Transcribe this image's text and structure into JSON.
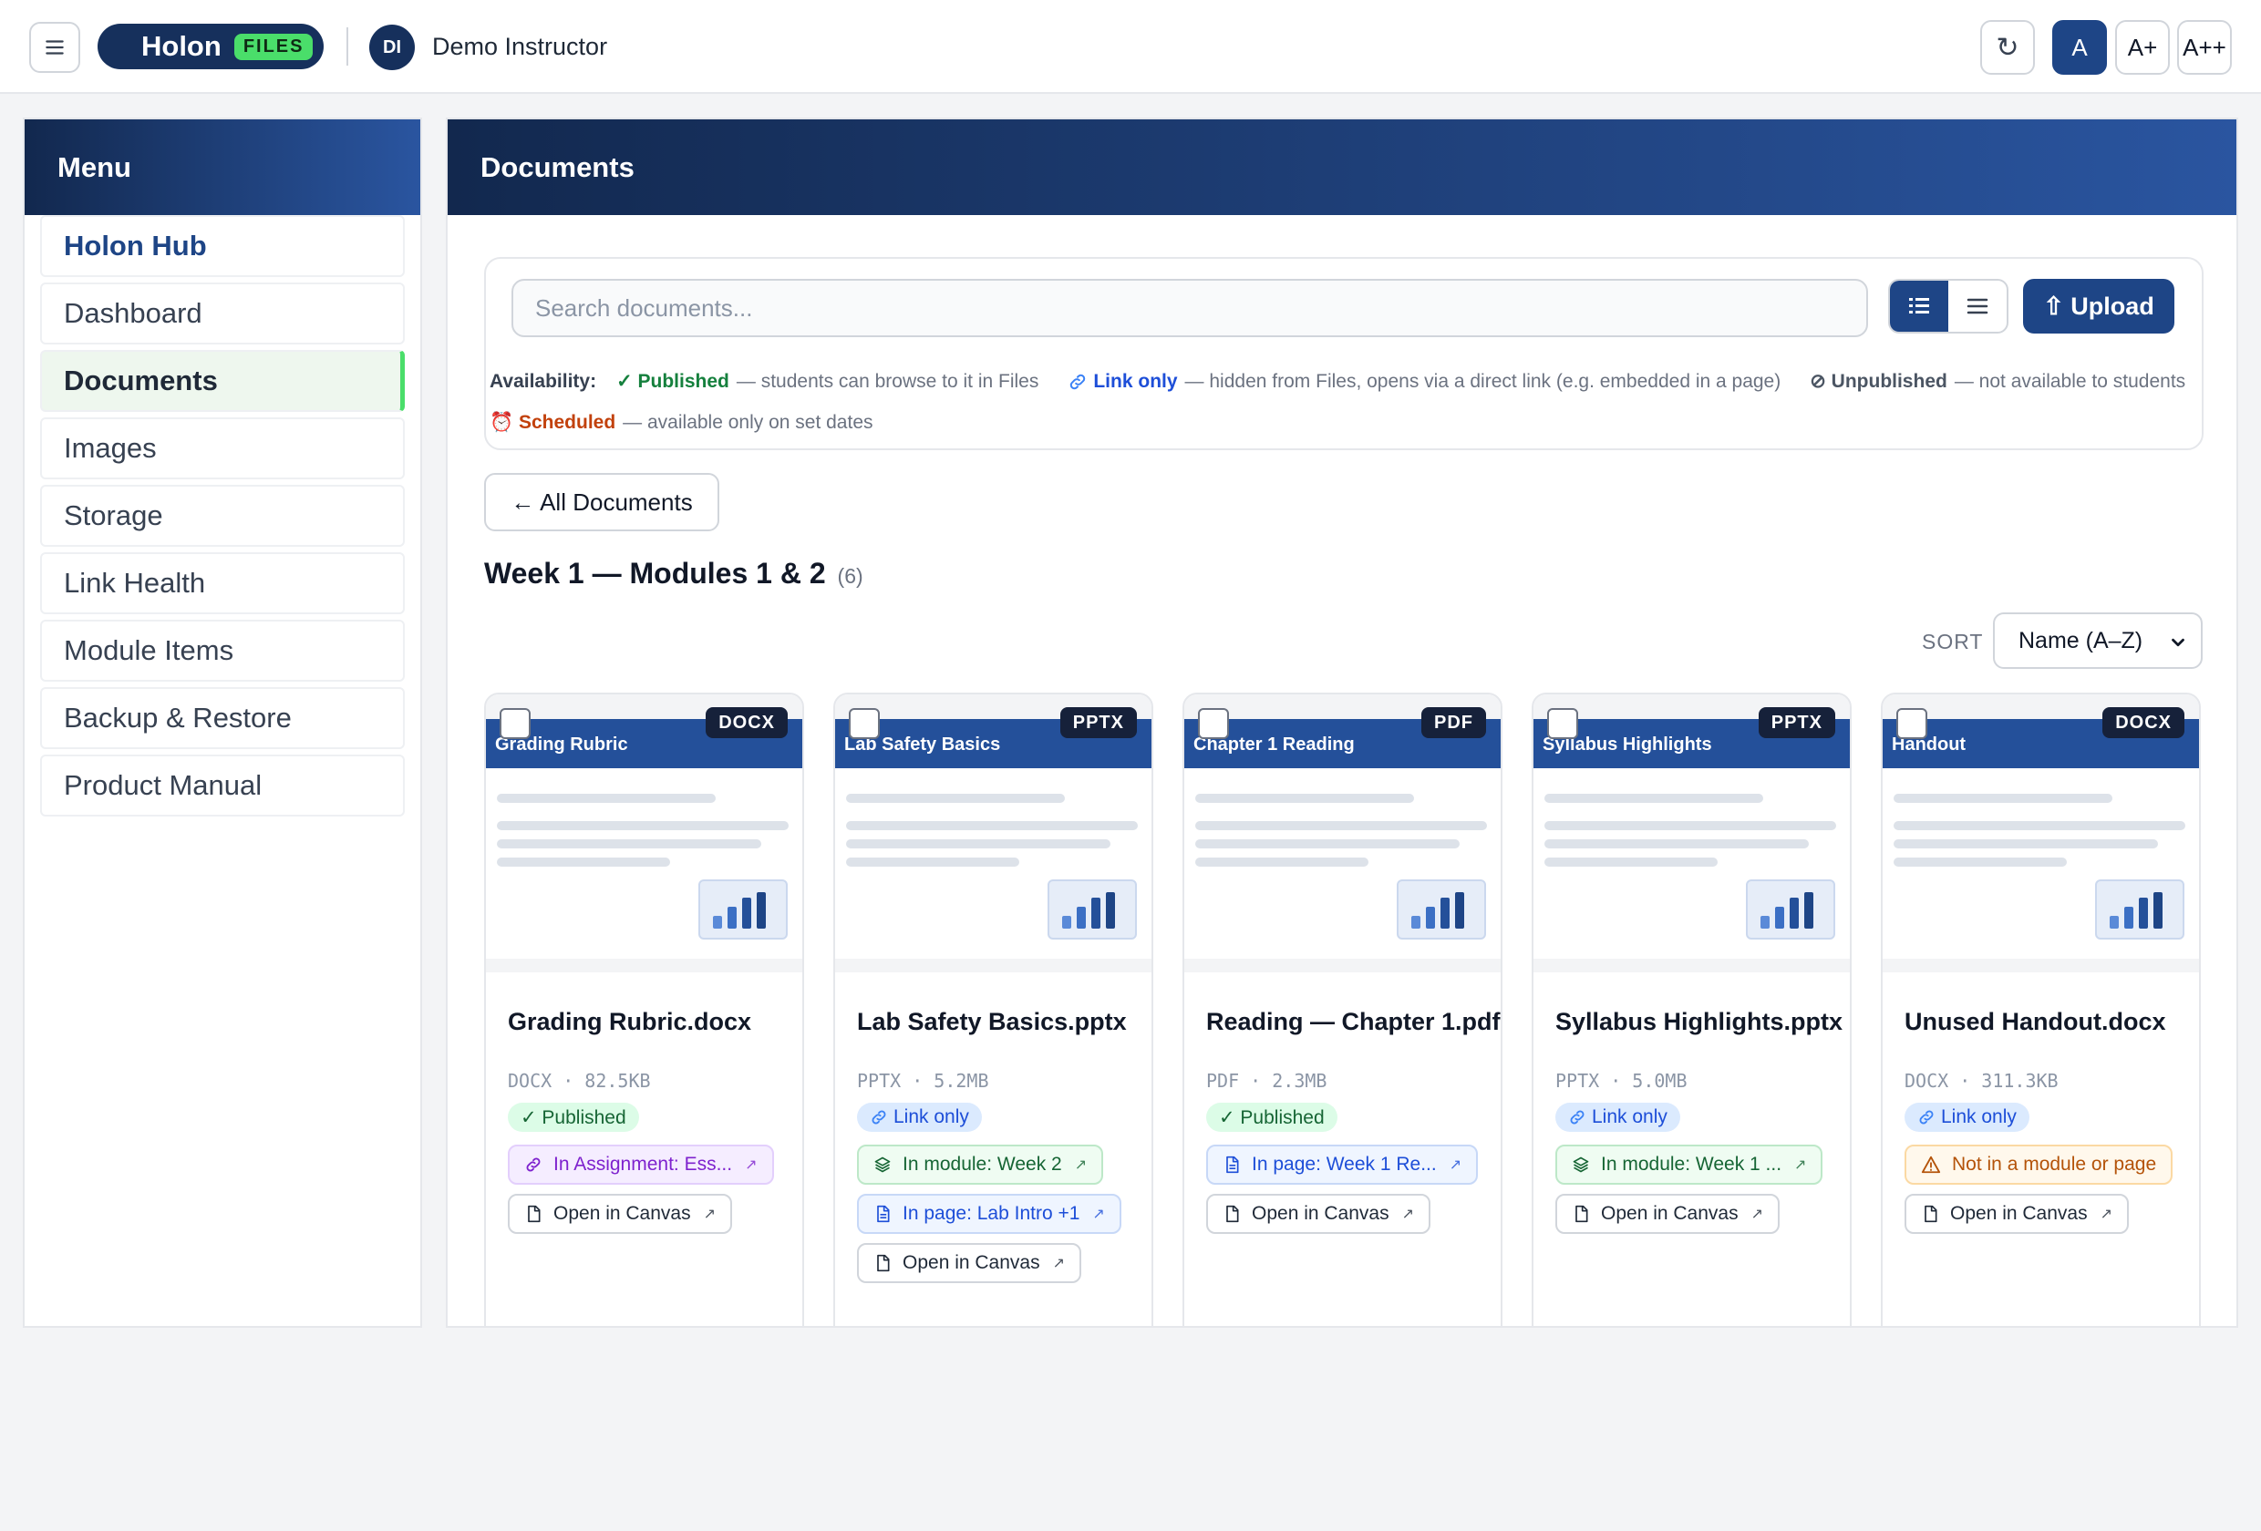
{
  "topbar": {
    "brand_name": "Holon",
    "brand_badge": "FILES",
    "avatar_initials": "DI",
    "user_name": "Demo Instructor",
    "refresh_glyph": "↻",
    "font_sizes": [
      "A",
      "A+",
      "A++"
    ],
    "active_font_size": "A"
  },
  "sidebar": {
    "title": "Menu",
    "items": [
      {
        "label": "Holon Hub"
      },
      {
        "label": "Dashboard"
      },
      {
        "label": "Documents"
      },
      {
        "label": "Images"
      },
      {
        "label": "Storage"
      },
      {
        "label": "Link Health"
      },
      {
        "label": "Module Items"
      },
      {
        "label": "Backup & Restore"
      },
      {
        "label": "Product Manual"
      }
    ],
    "active_item": "Documents"
  },
  "main": {
    "title": "Documents",
    "search": {
      "placeholder": "Search documents...",
      "value": ""
    },
    "upload_label": "⇧ Upload",
    "availability": {
      "label": "Availability:",
      "published_key": "✓ Published",
      "published_desc": "— students can browse to it in Files",
      "link_key": "Link only",
      "link_desc": "— hidden from Files, opens via a direct link (e.g. embedded in a page)",
      "unpublished_key": "⊘ Unpublished",
      "unpublished_desc": "— not available to students",
      "scheduled_key": "⏰ Scheduled",
      "scheduled_desc": "— available only on set dates"
    },
    "back_label": "← All Documents",
    "group_title": "Week 1 — Modules 1 & 2",
    "group_count": "(6)",
    "sort_label": "SORT",
    "sort_value": "Name (A–Z)"
  },
  "documents": [
    {
      "banner_title": "Grading Rubric",
      "type": "DOCX",
      "filename": "Grading Rubric.docx",
      "meta": "DOCX · 82.5KB",
      "status": "✓ Published",
      "chips": [
        {
          "kind": "assign",
          "label": "In Assignment: Ess..."
        },
        {
          "kind": "canvas",
          "label": "Open in Canvas"
        }
      ]
    },
    {
      "banner_title": "Lab Safety Basics",
      "type": "PPTX",
      "filename": "Lab Safety Basics.pptx",
      "meta": "PPTX · 5.2MB",
      "status": "Link only",
      "chips": [
        {
          "kind": "module",
          "label": "In module: Week 2"
        },
        {
          "kind": "page",
          "label": "In page: Lab Intro +1"
        },
        {
          "kind": "canvas",
          "label": "Open in Canvas"
        }
      ]
    },
    {
      "banner_title": "Chapter 1 Reading",
      "type": "PDF",
      "filename": "Reading — Chapter 1.pdf",
      "meta": "PDF · 2.3MB",
      "status": "✓ Published",
      "chips": [
        {
          "kind": "page",
          "label": "In page: Week 1 Re..."
        },
        {
          "kind": "canvas",
          "label": "Open in Canvas"
        }
      ]
    },
    {
      "banner_title": "Syllabus Highlights",
      "type": "PPTX",
      "filename": "Syllabus Highlights.pptx",
      "meta": "PPTX · 5.0MB",
      "status": "Link only",
      "chips": [
        {
          "kind": "module",
          "label": "In module: Week 1 ..."
        },
        {
          "kind": "canvas",
          "label": "Open in Canvas"
        }
      ]
    },
    {
      "banner_title": "Handout",
      "type": "DOCX",
      "filename": "Unused Handout.docx",
      "meta": "DOCX · 311.3KB",
      "status": "Link only",
      "chips": [
        {
          "kind": "warn",
          "label": "Not in a module or page"
        },
        {
          "kind": "canvas",
          "label": "Open in Canvas"
        }
      ]
    }
  ],
  "colors": {
    "brand_navy": "#16305c",
    "accent_blue": "#1e4586",
    "files_green": "#4ade6a",
    "published_green": "#15803d",
    "link_blue": "#1d4ed8",
    "scheduled_orange": "#c2410c"
  },
  "icons": {
    "menu": "hamburger-icon",
    "refresh": "refresh-icon",
    "grid_view": "grid-view-icon",
    "list_view": "list-view-icon",
    "link": "link-icon",
    "module": "layers-icon",
    "page": "document-icon",
    "canvas": "file-icon",
    "warning": "warning-icon",
    "external": "external-link-icon",
    "chart": "bar-chart-icon"
  }
}
